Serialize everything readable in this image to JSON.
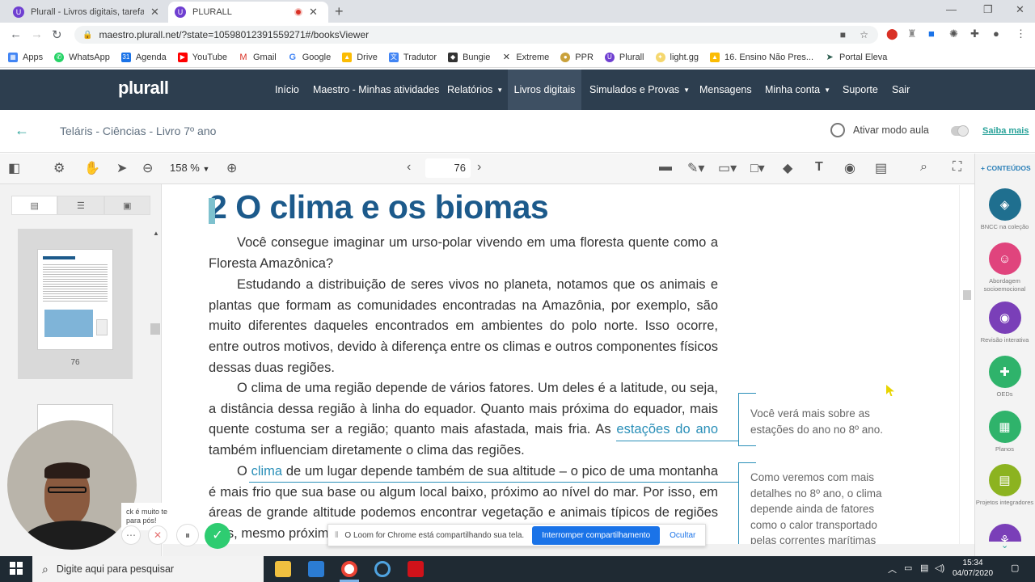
{
  "browser": {
    "tabs": [
      {
        "title": "Plurall - Livros digitais, tarefas, tu",
        "active": false
      },
      {
        "title": "PLURALL",
        "active": true
      }
    ],
    "url": "maestro.plurall.net/?state=10598012391559271#/booksViewer",
    "bookmarks": [
      "Apps",
      "WhatsApp",
      "Agenda",
      "YouTube",
      "Gmail",
      "Google",
      "Drive",
      "Tradutor",
      "Bungie",
      "Extreme",
      "PPR",
      "Plurall",
      "light.gg",
      "16. Ensino Não Pres...",
      "Portal Eleva"
    ]
  },
  "site": {
    "logo": "plurall",
    "nav": [
      {
        "label": "Início"
      },
      {
        "label": "Maestro - Minhas atividades"
      },
      {
        "label": "Relatórios",
        "caret": "▼"
      },
      {
        "label": "Livros digitais",
        "active": true
      },
      {
        "label": "Simulados e Provas",
        "caret": "▼"
      },
      {
        "label": "Mensagens"
      },
      {
        "label": "Minha conta",
        "caret": "▼"
      },
      {
        "label": "Suporte"
      },
      {
        "label": "Sair"
      }
    ],
    "book_title": "Teláris - Ciências - Livro 7º ano",
    "mode_label": "Ativar modo aula",
    "saiba_mais": "Saiba mais"
  },
  "viewer": {
    "zoom": "158 %",
    "page": "76",
    "thumb_page": "76",
    "conteudos": "+ CONTEÚDOS",
    "right_items": [
      {
        "label": "BNCC na coleção",
        "color": "#1f6f8f",
        "icon": "◈"
      },
      {
        "label": "Abordagem socioemocional",
        "color": "#e0447d",
        "icon": "☺"
      },
      {
        "label": "Revisão interativa",
        "color": "#7a3fb8",
        "icon": "◉"
      },
      {
        "label": "OEDs",
        "color": "#2fb36b",
        "icon": "✚"
      },
      {
        "label": "Planos",
        "color": "#2fb36b",
        "icon": "▦"
      },
      {
        "label": "Projetos integradores",
        "color": "#8cb320",
        "icon": "▤"
      }
    ]
  },
  "page": {
    "heading_num": "2",
    "heading": "O clima e os biomas",
    "p1": "Você consegue imaginar um urso-polar vivendo em uma floresta quente como a Floresta Amazônica?",
    "p2": "Estudando a distribuição de seres vivos no planeta, notamos que os animais e plantas que formam as comunidades encontradas na Amazônia, por exemplo, são muito diferentes daqueles encontrados em ambientes do polo norte. Isso ocorre, entre outros motivos, devido à diferença entre os climas e outros componentes físicos dessas duas regiões.",
    "p3a": "O clima de uma região depende de vários fatores. Um deles é a latitude, ou seja, a distância dessa região à linha do equador. Quanto mais próxima do equador, mais quente costuma ser a região; quanto mais afastada, mais fria. As ",
    "p3link": "estações do ano",
    "p3b": " também influenciam diretamente o clima das regiões.",
    "p4a": "O ",
    "p4link": "clima",
    "p4b": " de um lugar depende também de sua altitude – o pico de uma montanha é mais frio que sua base ou algum local baixo, próximo ao nível do mar. Por isso, em áreas de grande altitude podemos encontrar vegetação e animais típicos de regiões frias, mesmo próximos ao equador.",
    "note1": "Você verá mais sobre as estações do ano no 8º ano.",
    "note2": "Como veremos com mais detalhes no 8º ano, o clima depende ainda de fatores como o calor transportado pelas correntes marítimas"
  },
  "loom": {
    "message": "O Loom for Chrome está compartilhando sua tela.",
    "stop": "Interromper compartilhamento",
    "hide": "Ocultar"
  },
  "webcam_tip": "ck é muito te para pós!",
  "taskbar": {
    "search": "Digite aqui para pesquisar",
    "time": "15:34",
    "date": "04/07/2020"
  }
}
